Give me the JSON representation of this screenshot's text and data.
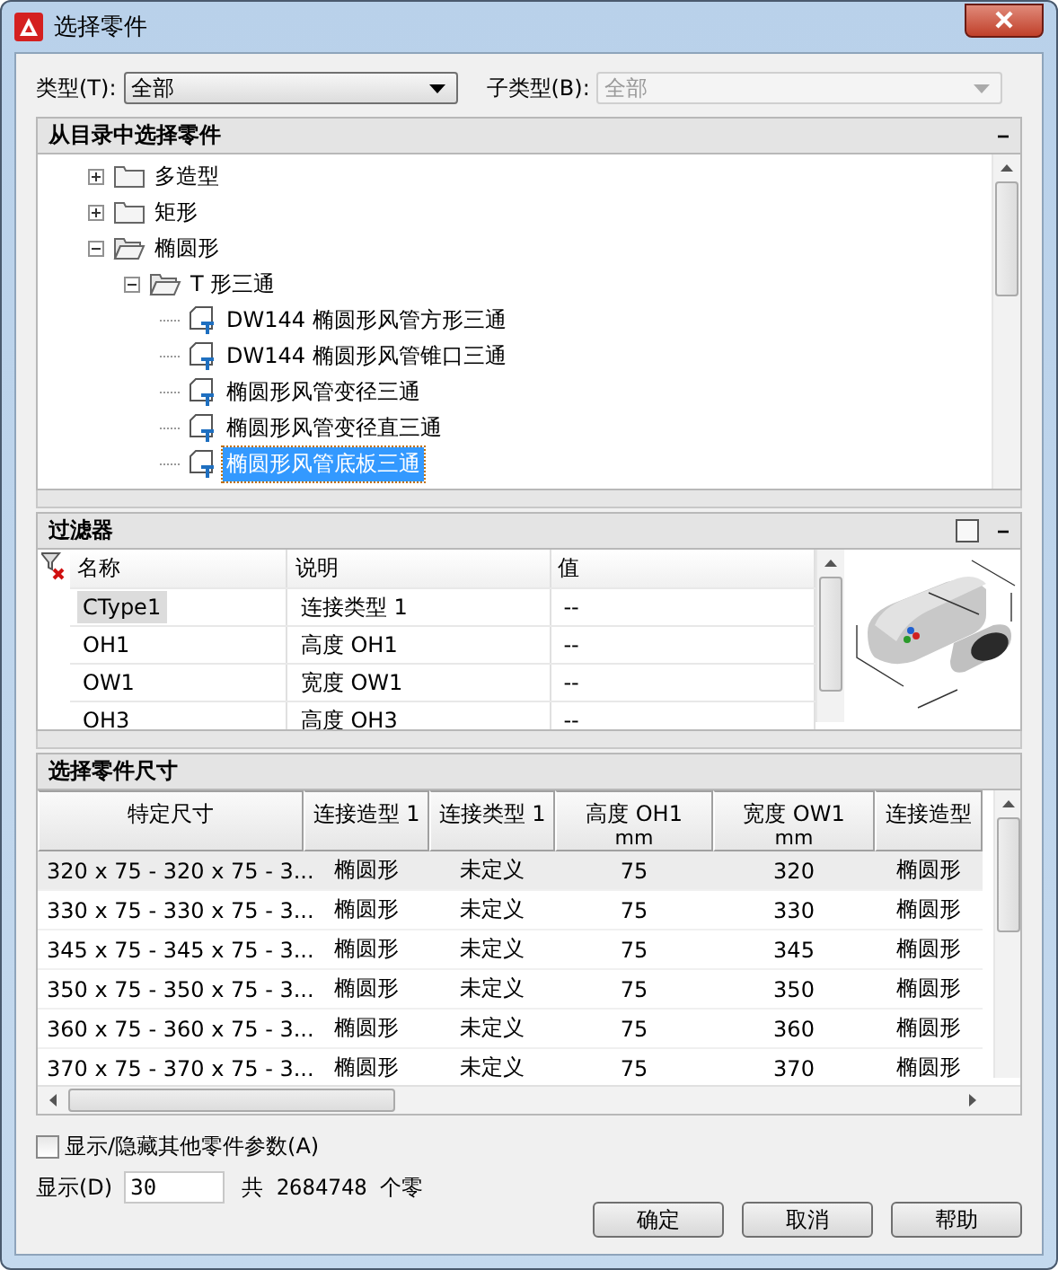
{
  "window": {
    "title": "选择零件"
  },
  "type_field": {
    "label": "类型(T):",
    "value": "全部",
    "disabled": false
  },
  "subtype_field": {
    "label": "子类型(B):",
    "value": "全部",
    "disabled": true
  },
  "catalog_panel": {
    "title": "从目录中选择零件",
    "collapse": "−",
    "tree": [
      {
        "label": "多造型",
        "kind": "folder",
        "expanded": false,
        "selected": false
      },
      {
        "label": "矩形",
        "kind": "folder",
        "expanded": false,
        "selected": false
      },
      {
        "label": "椭圆形",
        "kind": "folder",
        "expanded": true,
        "selected": false,
        "children": [
          {
            "label": "T 形三通",
            "kind": "folder",
            "expanded": true,
            "selected": false,
            "children": [
              {
                "label": "DW144 椭圆形风管方形三通",
                "kind": "part",
                "selected": false
              },
              {
                "label": "DW144 椭圆形风管锥口三通",
                "kind": "part",
                "selected": false
              },
              {
                "label": "椭圆形风管变径三通",
                "kind": "part",
                "selected": false
              },
              {
                "label": "椭圆形风管变径直三通",
                "kind": "part",
                "selected": false
              },
              {
                "label": "椭圆形风管底板三通",
                "kind": "part",
                "selected": true
              }
            ]
          }
        ]
      }
    ]
  },
  "filter_panel": {
    "title": "过滤器",
    "collapse": "−",
    "columns": [
      "名称",
      "说明",
      "值"
    ],
    "rows": [
      {
        "cells": [
          "CType1",
          "连接类型 1",
          "--"
        ],
        "selected": true
      },
      {
        "cells": [
          "OH1",
          "高度 OH1",
          "--"
        ],
        "selected": false
      },
      {
        "cells": [
          "OW1",
          "宽度 OW1",
          "--"
        ],
        "selected": false
      },
      {
        "cells": [
          "OH3",
          "高度 OH3",
          "--"
        ],
        "selected": false
      }
    ]
  },
  "sizes_panel": {
    "title": "选择零件尺寸",
    "columns": [
      {
        "label": "特定尺寸"
      },
      {
        "label": "连接造型 1"
      },
      {
        "label": "连接类型 1"
      },
      {
        "label": "高度 OH1",
        "unit": "mm"
      },
      {
        "label": "宽度 OW1",
        "unit": "mm"
      },
      {
        "label": "连接造型"
      }
    ],
    "rows": [
      {
        "cells": [
          "320 x 75 - 320 x 75 - 3...",
          "椭圆形",
          "未定义",
          "75",
          "320",
          "椭圆形"
        ],
        "selected": true
      },
      {
        "cells": [
          "330 x 75 - 330 x 75 - 3...",
          "椭圆形",
          "未定义",
          "75",
          "330",
          "椭圆形"
        ],
        "selected": false
      },
      {
        "cells": [
          "345 x 75 - 345 x 75 - 3...",
          "椭圆形",
          "未定义",
          "75",
          "345",
          "椭圆形"
        ],
        "selected": false
      },
      {
        "cells": [
          "350 x 75 - 350 x 75 - 3...",
          "椭圆形",
          "未定义",
          "75",
          "350",
          "椭圆形"
        ],
        "selected": false
      },
      {
        "cells": [
          "360 x 75 - 360 x 75 - 3...",
          "椭圆形",
          "未定义",
          "75",
          "360",
          "椭圆形"
        ],
        "selected": false
      },
      {
        "cells": [
          "370 x 75 - 370 x 75 - 3...",
          "椭圆形",
          "未定义",
          "75",
          "370",
          "椭圆形"
        ],
        "selected": false
      }
    ]
  },
  "show_hide_checkbox": {
    "label": "显示/隐藏其他零件参数(A)",
    "checked": false
  },
  "display": {
    "label": "显示(D)",
    "value": "30",
    "total": "共 2684748 个零"
  },
  "buttons": [
    "确定",
    "取消",
    "帮助"
  ]
}
